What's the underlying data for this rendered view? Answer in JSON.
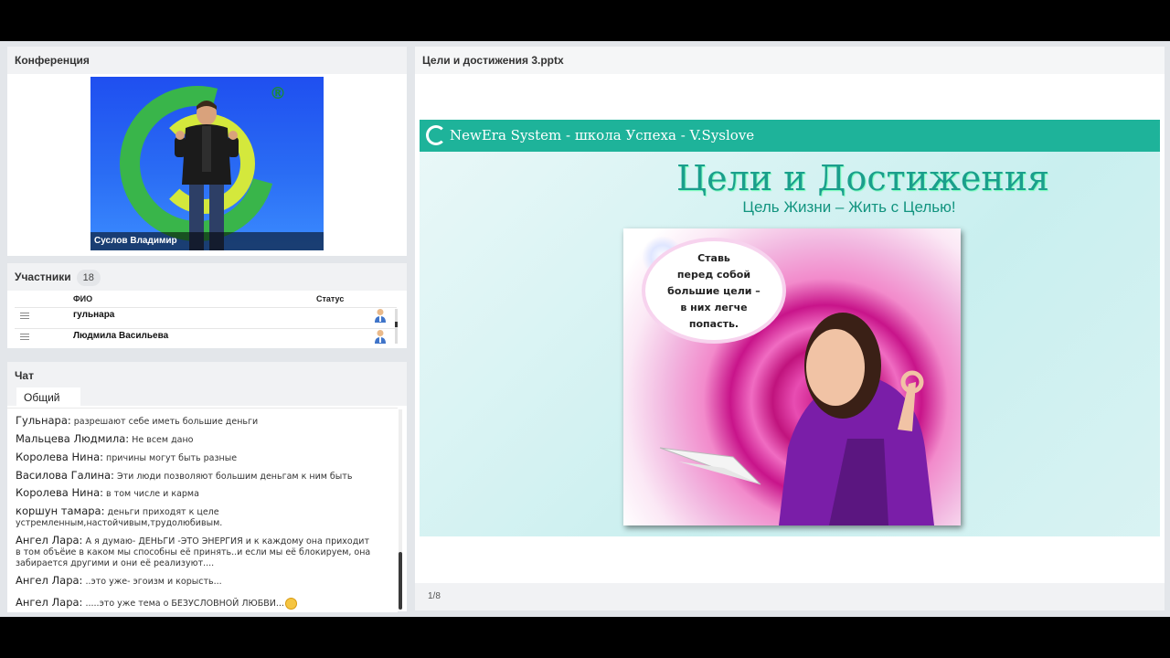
{
  "conference": {
    "title": "Конференция",
    "video_caption": "Суслов Владимир",
    "logo_mark": "®"
  },
  "participants": {
    "title": "Участники",
    "count": "18",
    "col_name": "ФИО",
    "col_status": "Статус",
    "rows": [
      {
        "name": "гульнара",
        "status_icon": "user-icon"
      },
      {
        "name": "Людмила Васильева",
        "status_icon": "user-icon"
      }
    ]
  },
  "chat": {
    "title": "Чат",
    "tab": "Общий",
    "messages": [
      {
        "who": "Гульнара:",
        "text": "разрешают себе иметь большие деньги"
      },
      {
        "who": "Мальцева Людмила:",
        "text": "Не всем дано"
      },
      {
        "who": "Королева Нина:",
        "text": "причины могут быть разные"
      },
      {
        "who": "Василова Галина:",
        "text": "Эти люди позволяют большим деньгам к  ним  быть"
      },
      {
        "who": "Королева Нина:",
        "text": "в том числе и карма"
      },
      {
        "who": "коршун тамара:",
        "text": "деньги приходят к целе устремленным,настойчивым,трудолюбивым."
      },
      {
        "who": "Ангел Лара:",
        "text": "А я думаю-  ДЕНЬГИ -ЭТО ЭНЕРГИЯ и к каждому она приходит в том объёие в каком мы способны её принять..и если мы её блокируем, она забирается другими и они её реализуют...."
      },
      {
        "who": "Ангел Лара:",
        "text": "..это уже- эгоизм и корысть..."
      },
      {
        "who": "Ангел Лара:",
        "text": ".....это уже тема о БЕЗУСЛОВНОЙ ЛЮБВИ..."
      }
    ]
  },
  "presentation": {
    "title": "Цели и достижения 3.pptx",
    "band_title": "NewEra System - школа Успеха - V.Syslove",
    "slide_title": "Цели и Достижения",
    "slide_subtitle": "Цель Жизни – Жить с Целью!",
    "bubble_lines": [
      "Ставь",
      "перед собой",
      "большие цели –",
      "в них легче",
      "попасть."
    ],
    "page": "1/8",
    "accent_color": "#1eb39a"
  }
}
